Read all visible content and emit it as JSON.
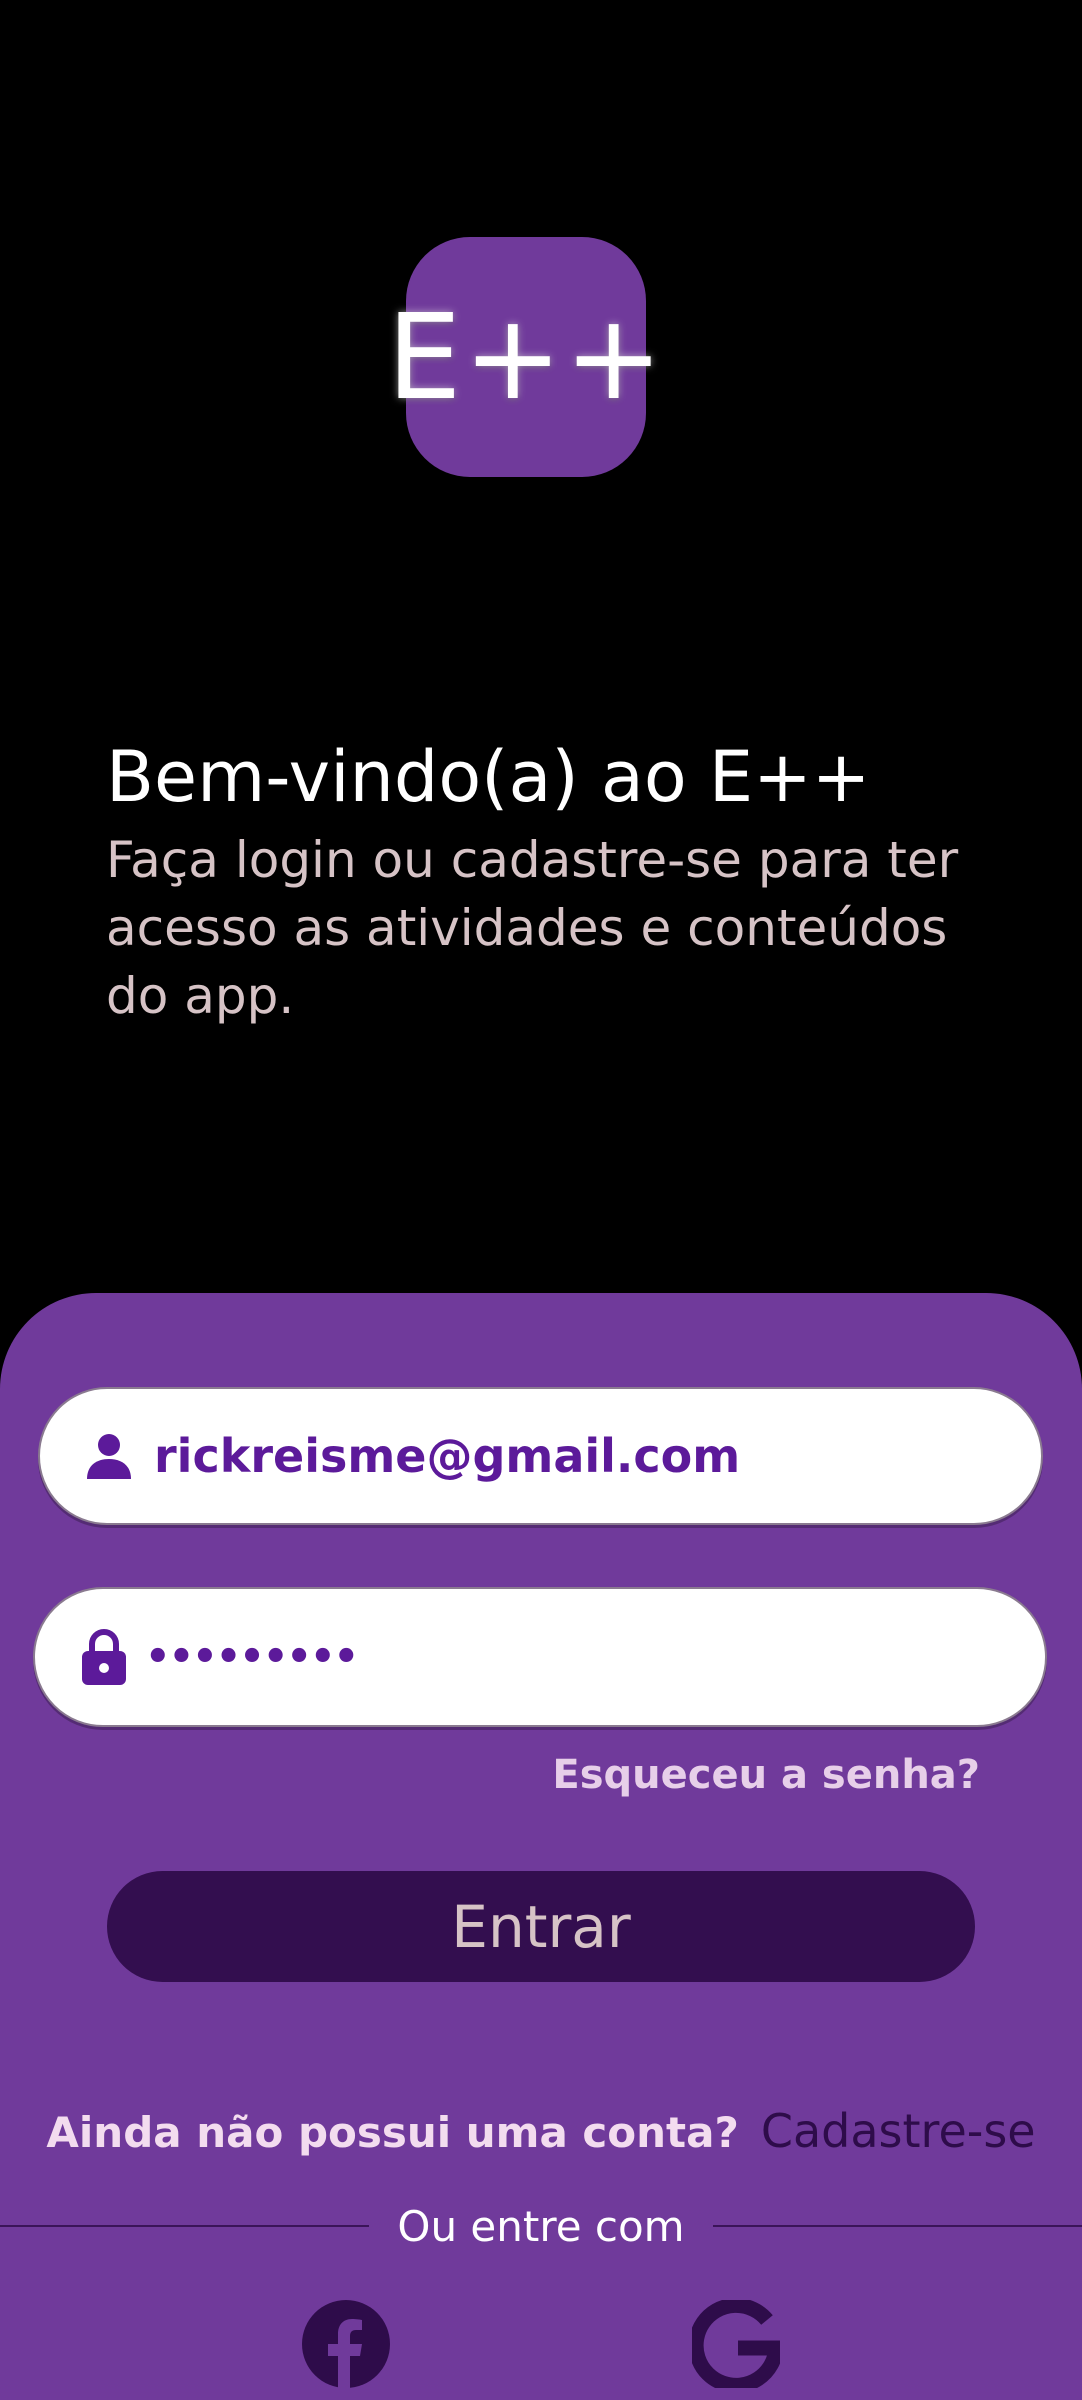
{
  "brand": {
    "logo_text": "E++",
    "accent": "#703a9b",
    "dark_accent": "#330e4f"
  },
  "welcome": {
    "title": "Bem-vindo(a) ao E++",
    "subtitle": "Faça login ou cadastre-se para ter acesso as atividades e conteúdos do app."
  },
  "login": {
    "email_value": "rickreisme@gmail.com",
    "password_value": "•••••••••",
    "email_icon": "person-icon",
    "password_icon": "lock-icon",
    "forgot_label": "Esqueceu a senha?",
    "submit_label": "Entrar"
  },
  "signup": {
    "prompt": "Ainda não possui uma conta?",
    "link": "Cadastre-se"
  },
  "social": {
    "divider_text": "Ou entre com",
    "providers": [
      "facebook-icon",
      "google-icon"
    ]
  }
}
